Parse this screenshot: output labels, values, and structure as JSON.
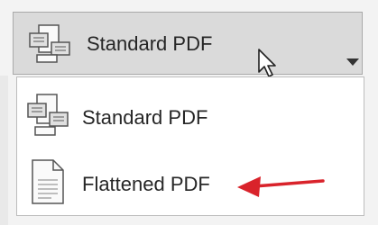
{
  "combo": {
    "selected_label": "Standard PDF",
    "icon": "standard-pdf-icon"
  },
  "dropdown": {
    "options": [
      {
        "label": "Standard PDF",
        "icon": "standard-pdf-icon"
      },
      {
        "label": "Flattened PDF",
        "icon": "flattened-pdf-icon"
      }
    ]
  },
  "annotation": {
    "arrow_color": "#d9232b"
  }
}
